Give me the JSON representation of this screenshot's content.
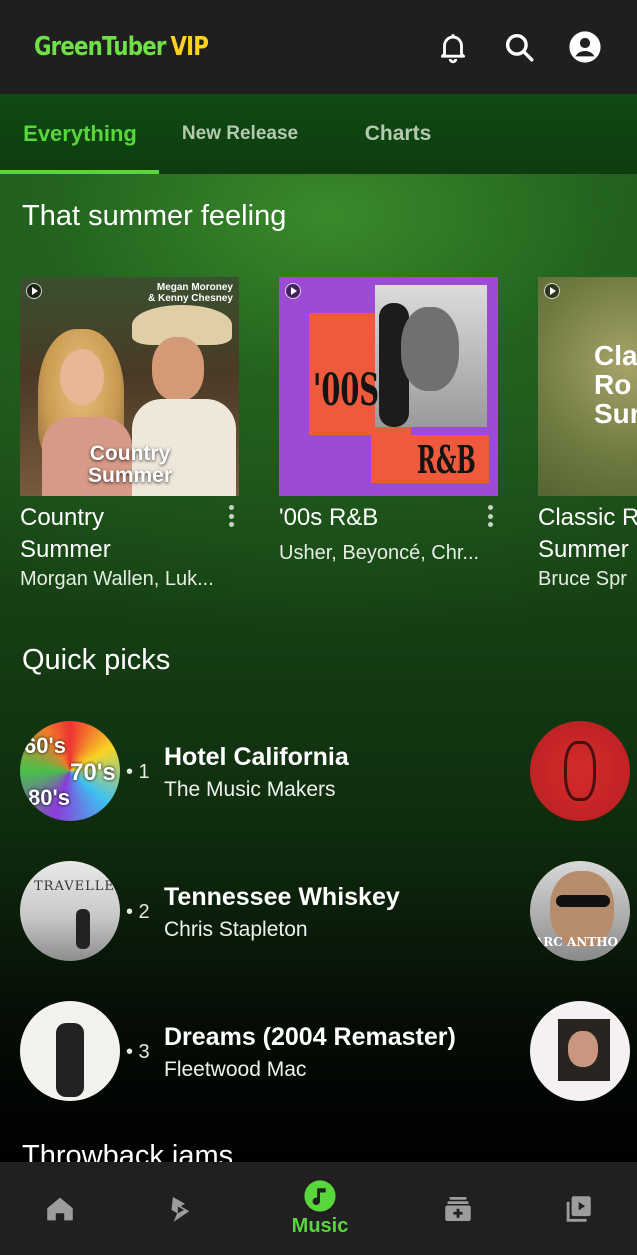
{
  "app": {
    "logo_main": "GreenTuber",
    "logo_vip": "VIP"
  },
  "header": {
    "notifications_icon": "bell-icon",
    "search_icon": "search-icon",
    "account_icon": "account-circle-icon"
  },
  "tabs": [
    {
      "label": "Everything",
      "active": true
    },
    {
      "label": "New Release",
      "active": false
    },
    {
      "label": "Charts",
      "active": false
    }
  ],
  "sections": {
    "summer_title": "That summer feeling",
    "quick_picks_title": "Quick picks",
    "throwback_title": "Throwback jams"
  },
  "playlists": [
    {
      "name": "Country\nSummer",
      "artists": "Morgan Wallen, Luk...",
      "cover_text": "Country\nSummer",
      "cover_credit": "Megan Moroney\n& Kenny Chesney"
    },
    {
      "name": "'00s R&B",
      "artists": "Usher, Beyoncé, Chr...",
      "cover_text_top": "'00S",
      "cover_text_bottom": "R&B"
    },
    {
      "name": "Classic R\nSummer",
      "artists": "Bruce Spr",
      "cover_text": "Cla\nRo\nSun"
    }
  ],
  "quick_picks": [
    {
      "rank": "• 1",
      "title": "Hotel California",
      "artist": "The Music Makers",
      "thumb_labels": [
        "60's",
        "70's",
        "80's"
      ]
    },
    {
      "rank": "• 2",
      "title": "Tennessee Whiskey",
      "artist": "Chris Stapleton",
      "thumb_text": "TRAVELLER"
    },
    {
      "rank": "• 3",
      "title": "Dreams (2004 Remaster)",
      "artist": "Fleetwood Mac"
    }
  ],
  "quick_picks_next_column": [
    {
      "thumb_text": ""
    },
    {
      "thumb_text": "ARC ANTHO"
    },
    {
      "thumb_text": ""
    }
  ],
  "bottom_nav": [
    {
      "icon": "home-icon",
      "label": "",
      "active": false
    },
    {
      "icon": "samples-icon",
      "label": "",
      "active": false
    },
    {
      "icon": "music-note-icon",
      "label": "Music",
      "active": true
    },
    {
      "icon": "library-add-icon",
      "label": "",
      "active": false
    },
    {
      "icon": "video-library-icon",
      "label": "",
      "active": false
    }
  ],
  "colors": {
    "accent_green": "#58d63c",
    "logo_green": "#6fe045",
    "logo_vip_yellow": "#ffd21f",
    "header_bg": "#1f1f1f",
    "nav_bg": "#202020",
    "icon_gray": "#9c9c9c"
  }
}
